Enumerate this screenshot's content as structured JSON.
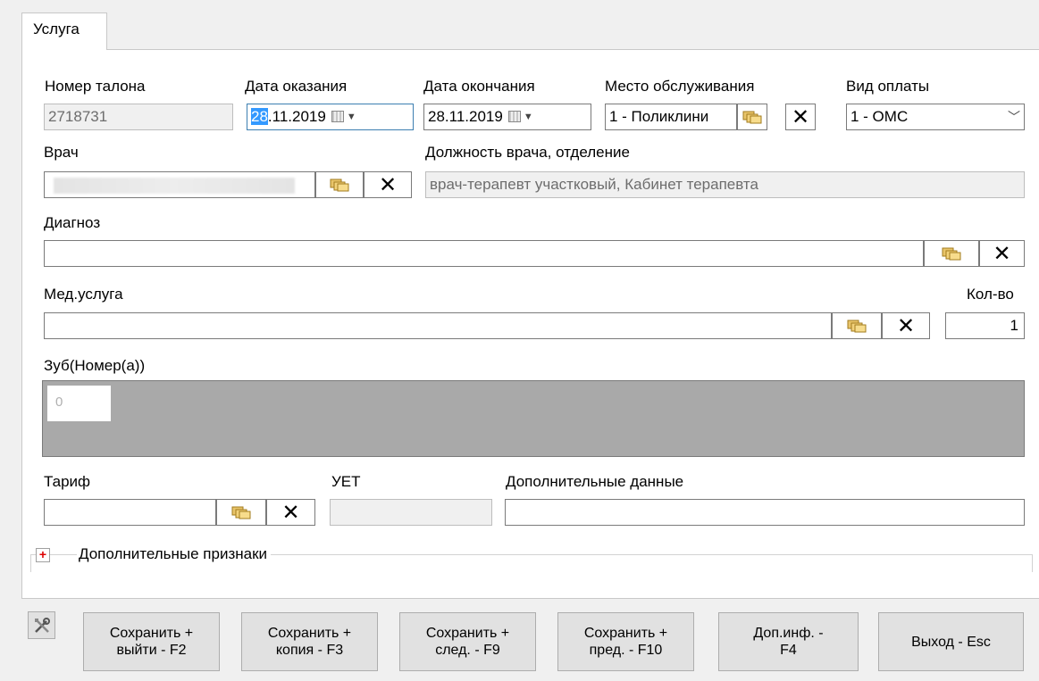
{
  "tab": {
    "label": "Услуга"
  },
  "labels": {
    "ticket_number": "Номер талона",
    "date_rendered": "Дата оказания",
    "date_end": "Дата окончания",
    "place": "Место обслуживания",
    "payment": "Вид оплаты",
    "doctor": "Врач",
    "doctor_position": "Должность врача, отделение",
    "diagnosis": "Диагноз",
    "med_service": "Мед.услуга",
    "quantity": "Кол-во",
    "tooth": "Зуб(Номер(а))",
    "tariff": "Тариф",
    "uet": "УЕТ",
    "extra_data": "Дополнительные данные",
    "extra_attributes": "Дополнительные признаки"
  },
  "values": {
    "ticket_number": "2718731",
    "date_rendered_day": "28",
    "date_rendered_rest": ".11.2019",
    "date_end": "28.11.2019",
    "place": "1 - Поликлини",
    "payment": "1 - ОМС",
    "doctor": "",
    "doctor_position": "врач-терапевт участковый, Кабинет терапевта",
    "diagnosis": "",
    "med_service": "",
    "quantity": "1",
    "tooth_cell": "0",
    "tariff": "",
    "uet": "",
    "extra_data": ""
  },
  "buttons": {
    "save_exit": "Сохранить +\nвыйти - F2",
    "save_copy": "Сохранить +\nкопия - F3",
    "save_next": "Сохранить +\nслед. - F9",
    "save_prev": "Сохранить +\nпред. - F10",
    "extra_info": "Доп.инф. -\nF4",
    "exit": "Выход - Esc"
  },
  "icons": {
    "clear": "✕",
    "dropdown": "﹀",
    "expander": "+"
  },
  "colors": {
    "selection": "#3399ff",
    "tooth_area": "#a9a9a9",
    "expander_plus": "#dd0000"
  }
}
